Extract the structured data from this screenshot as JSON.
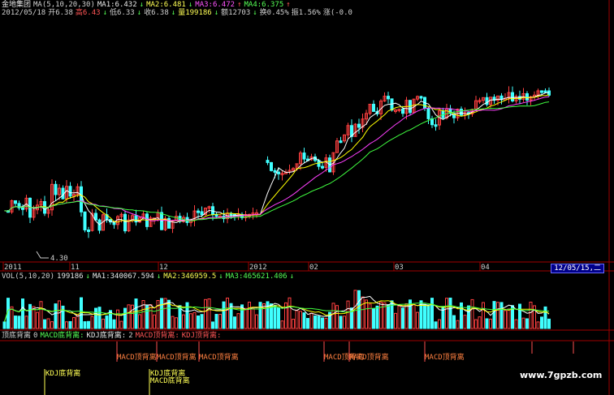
{
  "price_header": {
    "name": "金地集团",
    "ma_label": "MA(5,10,20,30)",
    "ma1": "MA1:6.432",
    "ma2": "MA2:6.481",
    "ma3": "MA3:6.472",
    "ma4": "MA4:6.375",
    "date": "2012/05/18",
    "open": "开6.38",
    "high": "高6.43",
    "low": "低6.33",
    "close": "收6.38",
    "volume": "量199186",
    "amount": "额12703",
    "turnover": "换0.45%",
    "amplitude": "振1.56%",
    "change": "涨(-0.0"
  },
  "price_axis": {
    "low_marker": "4.30",
    "months": [
      "2011",
      "11",
      "12",
      "2012",
      "02",
      "03",
      "04"
    ],
    "current_date": "12/05/15,二"
  },
  "volume_header": {
    "label": "VOL(5,10,20)",
    "vol": "199186",
    "ma1": "MA1:340067.594",
    "ma2": "MA2:346959.5",
    "ma3": "MA3:465621.406"
  },
  "signal_header": {
    "title": "顶底背离",
    "value": "0",
    "macd_bottom": "MACD底背离:",
    "kdj_bottom": "KDJ底背离:",
    "value2": "2",
    "macd_top": "MACD顶背离:",
    "kdj_top": "KDJ顶背离:"
  },
  "signal_labels": {
    "macd_top": "MACD顶背离",
    "kdj_bottom": "KDJ底背离",
    "macd_bottom": "MACD底背离"
  },
  "watermark": "www.7gpzb.com",
  "colors": {
    "up": "#ff4040",
    "down": "#40ffff",
    "ma1": "#ffffff",
    "ma2": "#ffff00",
    "ma3": "#ff40ff",
    "ma4": "#40ff40",
    "axis": "#a00000"
  }
}
